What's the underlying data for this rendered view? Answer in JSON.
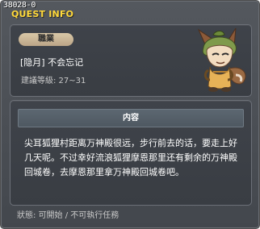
{
  "window": {
    "quest_id": "38028-0",
    "title": "QUEST INFO"
  },
  "job": {
    "badge": "職業",
    "name": "[隐月] 不会忘记",
    "level": "建議等級: 27~31"
  },
  "content": {
    "header": "内容",
    "description": "尖耳狐狸村距离万神殿很远，步行前去的话，要走上好几天呢。不过幸好流浪狐狸摩恩那里还有剩余的万神殿回城卷，去摩恩那里拿万神殿回城卷吧。"
  },
  "status": {
    "text": "狀態: 可開始 / 不可執行任務"
  },
  "colors": {
    "title": "#ffd93a",
    "badge": "#cbb796",
    "panel": "#3c4046"
  },
  "icons": {
    "npc": "fox-npc-illustration"
  }
}
